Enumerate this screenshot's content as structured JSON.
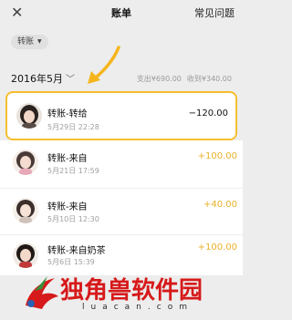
{
  "header": {
    "close_glyph": "✕",
    "title": "账单",
    "faq": "常见问题"
  },
  "filter": {
    "label": "转账",
    "caret": "▼"
  },
  "summary": {
    "month": "2016年5月",
    "chevron": "﹀",
    "expense": "支出¥690.00",
    "income": "收到¥340.00"
  },
  "transactions": [
    {
      "name": "转账-转给",
      "date": "5月29日 22:28",
      "amount": "−120.00",
      "type": "out",
      "highlighted": true
    },
    {
      "name": "转账-来自",
      "date": "5月21日 17:59",
      "amount": "+100.00",
      "type": "in"
    },
    {
      "name": "转账-来自",
      "date": "5月10日 12:30",
      "amount": "+40.00",
      "type": "in"
    },
    {
      "name": "转账-来自奶茶",
      "date": "5月6日 15:39",
      "amount": "+100.00",
      "type": "in"
    }
  ],
  "watermark": {
    "brand": "独角兽软件园",
    "url": "luacan.com"
  },
  "colors": {
    "highlight_border": "#f5bf2e",
    "income_amount": "#e8b12a",
    "arrow": "#f5b51c",
    "brand_red": "#d6191a"
  }
}
